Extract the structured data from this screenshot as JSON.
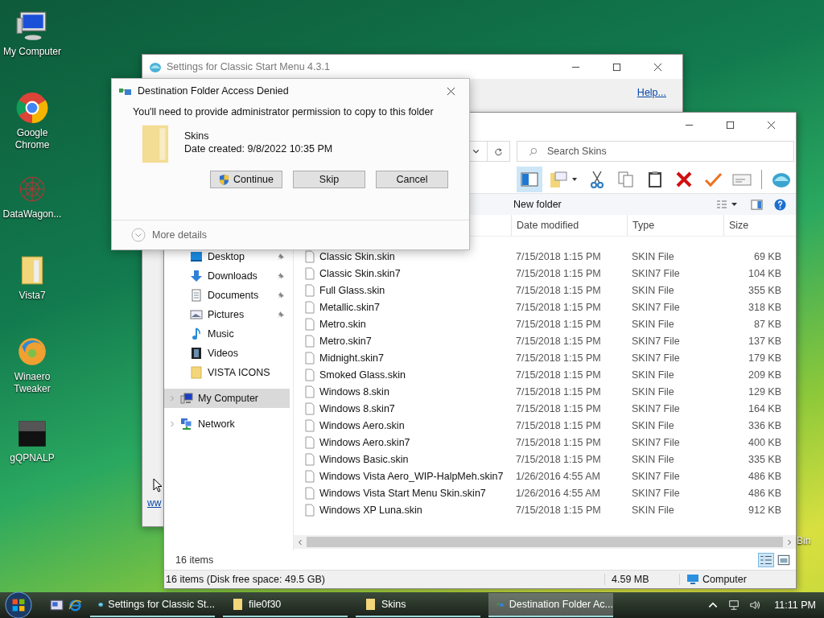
{
  "desktop": {
    "icons": [
      {
        "label": "My Computer",
        "kind": "computer"
      },
      {
        "label": "Google Chrome",
        "kind": "chrome"
      },
      {
        "label": "DataWagon...",
        "kind": "web"
      },
      {
        "label": "Vista7",
        "kind": "folder"
      },
      {
        "label": "Winaero Tweaker",
        "kind": "winaero"
      },
      {
        "label": "gQPNALP",
        "kind": "black"
      }
    ],
    "bin_fragment": "Bin"
  },
  "settings_window": {
    "title": "Settings for Classic Start Menu 4.3.1",
    "help_link": "Help...",
    "link_fragment": "ww"
  },
  "explorer": {
    "search": {
      "placeholder": "Search Skins"
    },
    "command_bar": {
      "new_folder": "New folder"
    },
    "quick_access": [
      {
        "label": "Desktop",
        "kind": "desktop",
        "pinned": true
      },
      {
        "label": "Downloads",
        "kind": "downloads",
        "pinned": true
      },
      {
        "label": "Documents",
        "kind": "documents",
        "pinned": true
      },
      {
        "label": "Pictures",
        "kind": "pictures",
        "pinned": true
      },
      {
        "label": "Music",
        "kind": "music",
        "pinned": false
      },
      {
        "label": "Videos",
        "kind": "videos",
        "pinned": false
      },
      {
        "label": "VISTA ICONS",
        "kind": "folder",
        "pinned": false
      }
    ],
    "tree": [
      {
        "label": "My Computer",
        "kind": "computer",
        "selected": true
      },
      {
        "label": "Network",
        "kind": "network",
        "selected": false
      }
    ],
    "columns": [
      "Date modified",
      "Type",
      "Size"
    ],
    "rows": [
      {
        "name": "Classic Skin.skin",
        "date": "7/15/2018 1:15 PM",
        "type": "SKIN File",
        "size": "69 KB"
      },
      {
        "name": "Classic Skin.skin7",
        "date": "7/15/2018 1:15 PM",
        "type": "SKIN7 File",
        "size": "104 KB"
      },
      {
        "name": "Full Glass.skin",
        "date": "7/15/2018 1:15 PM",
        "type": "SKIN File",
        "size": "355 KB"
      },
      {
        "name": "Metallic.skin7",
        "date": "7/15/2018 1:15 PM",
        "type": "SKIN7 File",
        "size": "318 KB"
      },
      {
        "name": "Metro.skin",
        "date": "7/15/2018 1:15 PM",
        "type": "SKIN File",
        "size": "87 KB"
      },
      {
        "name": "Metro.skin7",
        "date": "7/15/2018 1:15 PM",
        "type": "SKIN7 File",
        "size": "137 KB"
      },
      {
        "name": "Midnight.skin7",
        "date": "7/15/2018 1:15 PM",
        "type": "SKIN7 File",
        "size": "179 KB"
      },
      {
        "name": "Smoked Glass.skin",
        "date": "7/15/2018 1:15 PM",
        "type": "SKIN File",
        "size": "209 KB"
      },
      {
        "name": "Windows 8.skin",
        "date": "7/15/2018 1:15 PM",
        "type": "SKIN File",
        "size": "129 KB"
      },
      {
        "name": "Windows 8.skin7",
        "date": "7/15/2018 1:15 PM",
        "type": "SKIN7 File",
        "size": "164 KB"
      },
      {
        "name": "Windows Aero.skin",
        "date": "7/15/2018 1:15 PM",
        "type": "SKIN File",
        "size": "336 KB"
      },
      {
        "name": "Windows Aero.skin7",
        "date": "7/15/2018 1:15 PM",
        "type": "SKIN7 File",
        "size": "400 KB"
      },
      {
        "name": "Windows Basic.skin",
        "date": "7/15/2018 1:15 PM",
        "type": "SKIN File",
        "size": "335 KB"
      },
      {
        "name": "Windows Vista Aero_WIP-HalpMeh.skin7",
        "date": "1/26/2016 4:55 AM",
        "type": "SKIN7 File",
        "size": "486 KB"
      },
      {
        "name": "Windows Vista Start Menu Skin.skin7",
        "date": "1/26/2016 4:55 AM",
        "type": "SKIN7 File",
        "size": "486 KB"
      },
      {
        "name": "Windows XP Luna.skin",
        "date": "7/15/2018 1:15 PM",
        "type": "SKIN File",
        "size": "912 KB"
      }
    ],
    "item_count": "16 items",
    "status_bar": {
      "summary": "16 items (Disk free space: 49.5 GB)",
      "size": "4.59 MB",
      "location": "Computer"
    }
  },
  "dialog": {
    "title": "Destination Folder Access Denied",
    "message": "You'll need to provide administrator permission to copy to this folder",
    "folder": {
      "name": "Skins",
      "date": "Date created: 9/8/2022 10:35 PM"
    },
    "buttons": [
      {
        "label": "Continue",
        "kind": "shield"
      },
      {
        "label": "Skip",
        "kind": "plain"
      },
      {
        "label": "Cancel",
        "kind": "plain"
      }
    ],
    "more_details": "More details"
  },
  "taskbar": {
    "tasks": [
      {
        "label": "Settings for Classic St...",
        "kind": "shell",
        "selected": false
      },
      {
        "label": "file0f30",
        "kind": "folder",
        "selected": false
      },
      {
        "label": "Skins",
        "kind": "folder",
        "selected": false
      },
      {
        "label": "Destination Folder Ac...",
        "kind": "copy",
        "selected": true
      }
    ],
    "clock": "11:11 PM"
  }
}
